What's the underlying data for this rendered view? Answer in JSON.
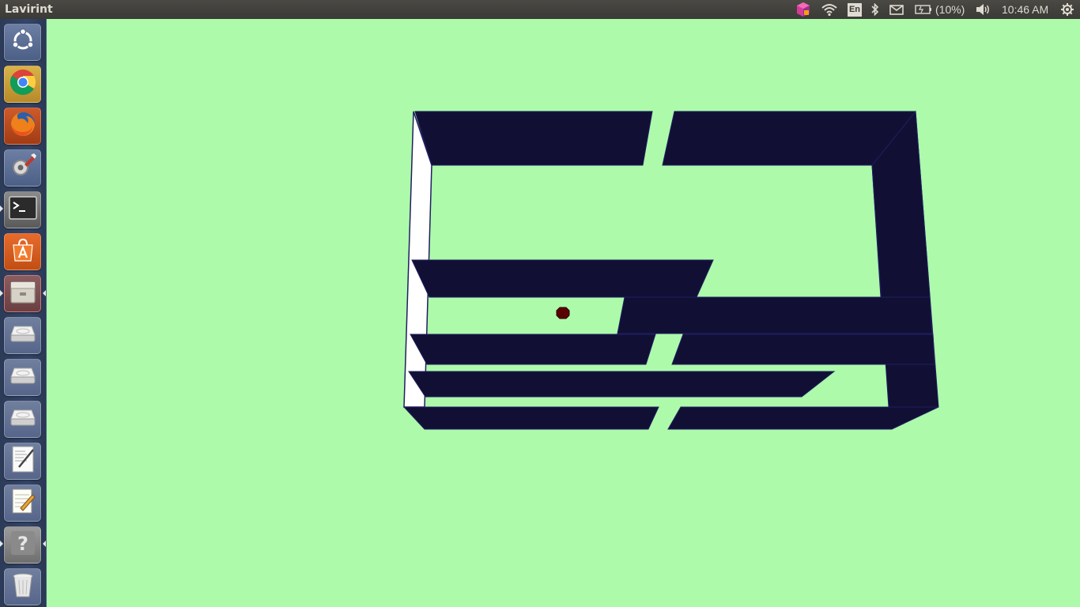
{
  "window": {
    "title": "Lavirint"
  },
  "tray": {
    "keyboard_layout": "En",
    "battery": "(10%)",
    "clock": "10:46 AM"
  },
  "launcher": {
    "items": [
      {
        "name": "dash-home",
        "icon": "ubuntu-logo-icon"
      },
      {
        "name": "chrome",
        "icon": "chrome-icon"
      },
      {
        "name": "firefox",
        "icon": "firefox-icon"
      },
      {
        "name": "system-settings",
        "icon": "settings-icon"
      },
      {
        "name": "terminal",
        "icon": "terminal-icon"
      },
      {
        "name": "software-center",
        "icon": "software-center-icon"
      },
      {
        "name": "files",
        "icon": "files-icon",
        "active": true
      },
      {
        "name": "drive-1",
        "icon": "drive-icon"
      },
      {
        "name": "drive-2",
        "icon": "drive-icon"
      },
      {
        "name": "drive-3",
        "icon": "drive-icon"
      },
      {
        "name": "text-editor",
        "icon": "text-editor-icon"
      },
      {
        "name": "gedit",
        "icon": "notepad-icon"
      },
      {
        "name": "help",
        "icon": "help-icon"
      },
      {
        "name": "trash",
        "icon": "trash-icon"
      }
    ]
  },
  "colors": {
    "background": "#adfaab",
    "wall": "#120f35",
    "wall_edge": "#1f1f60",
    "side_wall": "#ffffff",
    "ball": "#5a0000"
  }
}
